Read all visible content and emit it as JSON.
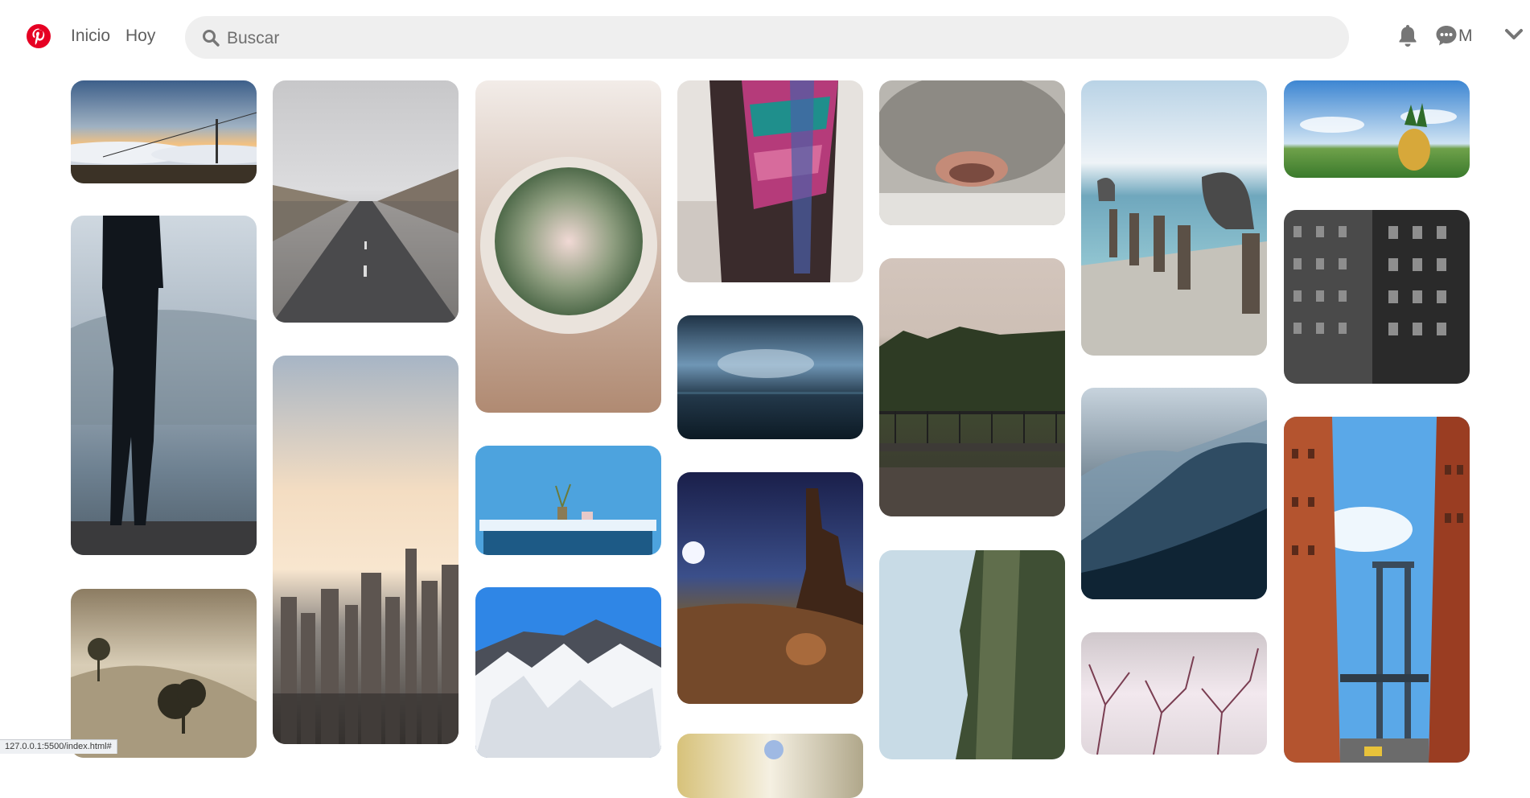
{
  "header": {
    "logo_icon": "pinterest-logo-icon",
    "nav": [
      "Inicio",
      "Hoy"
    ],
    "search": {
      "placeholder": "Buscar",
      "value": ""
    },
    "icons": [
      "bell-icon",
      "chat-icon"
    ],
    "avatar_initial": "M",
    "menu_icon": "chevron-down-icon",
    "brand_color": "#e60023"
  },
  "pins": [
    {
      "subject": "sunset ski lift over clouds"
    },
    {
      "subject": "man standing by misty lake"
    },
    {
      "subject": "sepia hills with trees"
    },
    {
      "subject": "empty mountain road"
    },
    {
      "subject": "city skyline at sunrise"
    },
    {
      "subject": "cactus in pot top view"
    },
    {
      "subject": "plant on blue table"
    },
    {
      "subject": "snowy mountain peaks"
    },
    {
      "subject": "colorful poncho"
    },
    {
      "subject": "stormy sea clouds"
    },
    {
      "subject": "desert rock at night"
    },
    {
      "subject": "cat nose close-up"
    },
    {
      "subject": "foggy forest balcony"
    },
    {
      "subject": "cliff with trees"
    },
    {
      "subject": "pelicans on pier"
    },
    {
      "subject": "blue misty mountains"
    },
    {
      "subject": "pink branches"
    },
    {
      "subject": "pineapple on grass"
    },
    {
      "subject": "black and white building"
    },
    {
      "subject": "Manhattan bridge street"
    }
  ],
  "status_bar": "127.0.0.1:5500/index.html#"
}
